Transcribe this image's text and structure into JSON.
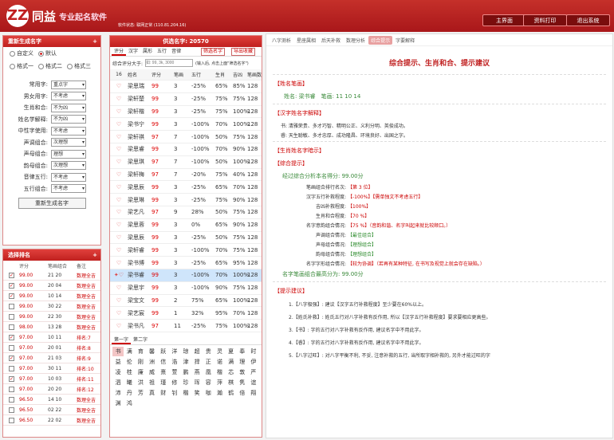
{
  "header": {
    "logo_mark": "ZZ",
    "app_name": "同益",
    "product": "专业起名软件",
    "status_label": "软件状态:",
    "status_value": "联网正常",
    "ip": "(110.81.204.16)",
    "buttons": [
      "主界面",
      "资料打印",
      "退出系统"
    ]
  },
  "regen_panel": {
    "title": "重新生成名字",
    "close": "+",
    "radios1": [
      "自定义",
      "默认"
    ],
    "radios2": [
      "格式一",
      "格式二",
      "格式三"
    ],
    "fields": [
      {
        "label": "常用字:",
        "value": "重点字"
      },
      {
        "label": "男女用字:",
        "value": "不考虑"
      },
      {
        "label": "生肖和合:",
        "value": "不为凶"
      },
      {
        "label": "姓名学解释:",
        "value": "不为凶"
      },
      {
        "label": "中性字使用:",
        "value": "不考虑"
      },
      {
        "label": "声调组合:",
        "value": "次理想"
      },
      {
        "label": "声母组合:",
        "value": "理想"
      },
      {
        "label": "韵母组合:",
        "value": "次理想"
      },
      {
        "label": "音律五行:",
        "value": "不考虑"
      },
      {
        "label": "五行组合:",
        "value": "不考虑"
      }
    ],
    "button": "重新生成名字"
  },
  "score_panel": {
    "title": "选择排名",
    "close": "+",
    "headers": [
      "评分",
      "笔画组合",
      "备注"
    ],
    "rows": [
      {
        "score": "99.00",
        "strokes": "21 20",
        "note": "数理全吉",
        "checked": true
      },
      {
        "score": "99.00",
        "strokes": "20 04",
        "note": "数理全吉",
        "checked": true
      },
      {
        "score": "99.00",
        "strokes": "10 14",
        "note": "数理全吉",
        "checked": true
      },
      {
        "score": "99.00",
        "strokes": "30 22",
        "note": "数理全吉",
        "checked": false
      },
      {
        "score": "99.00",
        "strokes": "22 30",
        "note": "数理全吉",
        "checked": false
      },
      {
        "score": "98.00",
        "strokes": "13 28",
        "note": "数理全吉",
        "checked": false
      },
      {
        "score": "97.00",
        "strokes": "10 11",
        "note": "排名:7",
        "checked": true
      },
      {
        "score": "97.00",
        "strokes": "20 01",
        "note": "排名:8",
        "checked": false
      },
      {
        "score": "97.00",
        "strokes": "21 03",
        "note": "排名:9",
        "checked": true
      },
      {
        "score": "97.00",
        "strokes": "30 11",
        "note": "排名:10",
        "checked": false
      },
      {
        "score": "97.00",
        "strokes": "10 03",
        "note": "排名:11",
        "checked": true
      },
      {
        "score": "97.00",
        "strokes": "20 20",
        "note": "排名:12",
        "checked": false
      },
      {
        "score": "96.50",
        "strokes": "14 10",
        "note": "数理全吉",
        "checked": false
      },
      {
        "score": "96.50",
        "strokes": "02 22",
        "note": "数理全吉",
        "checked": false
      },
      {
        "score": "96.50",
        "strokes": "22 02",
        "note": "数理全吉",
        "checked": false
      }
    ]
  },
  "names_panel": {
    "title": "供选名字: 20570",
    "tabs": [
      "评分",
      "汉字",
      "属形",
      "五行",
      "音律"
    ],
    "btn1": "筛选名字",
    "btn2": "导出收藏",
    "filter_label": "综合评分大于:",
    "filter_placeholder": "如: 99, 3k, 3000",
    "filter_hint": "(输入后, 点击上面\"筛选名字\")",
    "headers": [
      "16",
      "姓名",
      "评分",
      "笔画",
      "五行",
      "生肖",
      "吉凶",
      "笔画数"
    ],
    "rows": [
      [
        "梁思瑞",
        "99",
        "3",
        "-25%",
        "65%",
        "85%",
        "128"
      ],
      [
        "梁轩楚",
        "99",
        "3",
        "-25%",
        "75%",
        "75%",
        "128"
      ],
      [
        "梁轩楷",
        "99",
        "3",
        "-25%",
        "75%",
        "100%",
        "128"
      ],
      [
        "梁书宁",
        "99",
        "3",
        "-100%",
        "70%",
        "100%",
        "128"
      ],
      [
        "梁轩祺",
        "97",
        "7",
        "-100%",
        "50%",
        "75%",
        "128"
      ],
      [
        "梁思睿",
        "99",
        "3",
        "-100%",
        "70%",
        "90%",
        "128"
      ],
      [
        "梁思琪",
        "97",
        "7",
        "-100%",
        "50%",
        "100%",
        "128"
      ],
      [
        "梁轩梅",
        "97",
        "7",
        "-20%",
        "75%",
        "40%",
        "128"
      ],
      [
        "梁思辰",
        "99",
        "3",
        "-25%",
        "65%",
        "70%",
        "128"
      ],
      [
        "梁思琳",
        "99",
        "3",
        "-25%",
        "75%",
        "90%",
        "128"
      ],
      [
        "梁艺凡",
        "97",
        "9",
        "28%",
        "50%",
        "75%",
        "128"
      ],
      [
        "梁思蓉",
        "99",
        "3",
        "0%",
        "65%",
        "90%",
        "128"
      ],
      [
        "梁思辰",
        "99",
        "3",
        "-25%",
        "50%",
        "75%",
        "128"
      ],
      [
        "梁轩睿",
        "99",
        "3",
        "-100%",
        "70%",
        "75%",
        "128"
      ],
      [
        "梁书博",
        "99",
        "3",
        "-25%",
        "65%",
        "95%",
        "128"
      ],
      [
        "梁书睿",
        "99",
        "3",
        "-100%",
        "70%",
        "100%",
        "128"
      ],
      [
        "梁思宇",
        "99",
        "3",
        "-100%",
        "90%",
        "75%",
        "128"
      ],
      [
        "梁宝文",
        "99",
        "2",
        "75%",
        "65%",
        "100%",
        "128"
      ],
      [
        "梁艺宸",
        "99",
        "1",
        "32%",
        "95%",
        "70%",
        "128"
      ],
      [
        "梁书凡",
        "97",
        "11",
        "-25%",
        "75%",
        "100%",
        "128"
      ]
    ],
    "char_tabs": [
      "第一字",
      "第二字"
    ],
    "chars": [
      "书",
      "满",
      "育",
      "馨",
      "跃",
      "洋",
      "琼",
      "超",
      "贵",
      "灵",
      "夏",
      "奉",
      "时",
      "益",
      "伦",
      "刚",
      "洲",
      "信",
      "浩",
      "津",
      "捍",
      "正",
      "诺",
      "满",
      "理",
      "伊",
      "凌",
      "桂",
      "廉",
      "威",
      "熹",
      "萱",
      "鹏",
      "燕",
      "凰",
      "楷",
      "芯",
      "敦",
      "严",
      "泗",
      "曦",
      "洪",
      "祖",
      "瑾",
      "修",
      "珍",
      "珲",
      "容",
      "萍",
      "棋",
      "隽",
      "谊",
      "沛",
      "丹",
      "芳",
      "真",
      "财",
      "钊",
      "楷",
      "笑",
      "咖",
      "瀚",
      "鹤",
      "倍",
      "翔",
      "渊",
      "鸿"
    ]
  },
  "result_panel": {
    "tabs": [
      "八字测析",
      "星座属相",
      "后天补救",
      "数理分析",
      "综合提示",
      "字要解释"
    ],
    "active_tab": "综合提示",
    "title": "综合提示、生肖和合、提示建议",
    "sec_name": "【姓名笔画】",
    "name_line": "姓名: 梁书睿　笔画: 11 10 14",
    "sec_meaning": "【汉字姓名字解释】",
    "meaning_1": "书: 清雅荣贵、多才巧智、精明公正、义利分明、英俊成功。",
    "meaning_2": "睿: 天生聪敏、多才忠厚、成功隆昌、环境良好、出国之字。",
    "sec_zodiac": "【生肖姓名字暗示】",
    "sec_summary": "【综合提示】",
    "total_score": "经过综合分析本名得分: 99.00分",
    "items": [
      {
        "k": "笔画组合排行名次:",
        "v": "【第 3 位】",
        "g": false
      },
      {
        "k": "汉字五行补救程度:",
        "v": "【-100%】【需单独文不考虑五行】",
        "g": false
      },
      {
        "k": "吉凶补救程度:",
        "v": "【100%】",
        "g": false
      },
      {
        "k": "生肖和合程度:",
        "v": "【70 %】",
        "g": false
      },
      {
        "k": "名字意韵组合情况:",
        "v": "【75 %】（音韵和谐、名字叫起来就比较顺口。）",
        "g": false
      },
      {
        "k": "声调组合情况:",
        "v": "【最佳组合】",
        "g": true
      },
      {
        "k": "声母组合情况:",
        "v": "【理想组合】",
        "g": true
      },
      {
        "k": "韵母组合情况:",
        "v": "【理想组合】",
        "g": true
      },
      {
        "k": "名字字形组合情况:",
        "v": "【较为协调】（若再有某种特征, 在书写及视觉上就会存在缺陷。）",
        "g": false
      }
    ],
    "final_score": "名字笔画组合最高分为: 99.00分",
    "sec_advice": "【提示建议】",
    "advice": [
      "1.【八字极强】: 建议【汉字五行补救程度】至少要在60%以上。",
      "2.【姓氏补救】: 姓氏五行对八字补救有反作用, 所以【汉字五行补救程度】要求要相应更高些。",
      "3.【书】: 字的五行对八字补救有反作用, 建议名字中不用此字。",
      "4.【睿】: 字的五行对八字补救有反作用, 建议名字中不用此字。",
      "5.【八字过旺】: 对八字平衡不利, 不妥, 注意补救的五行, 当所取字相补救的, 另外才能过旺的字"
    ]
  }
}
